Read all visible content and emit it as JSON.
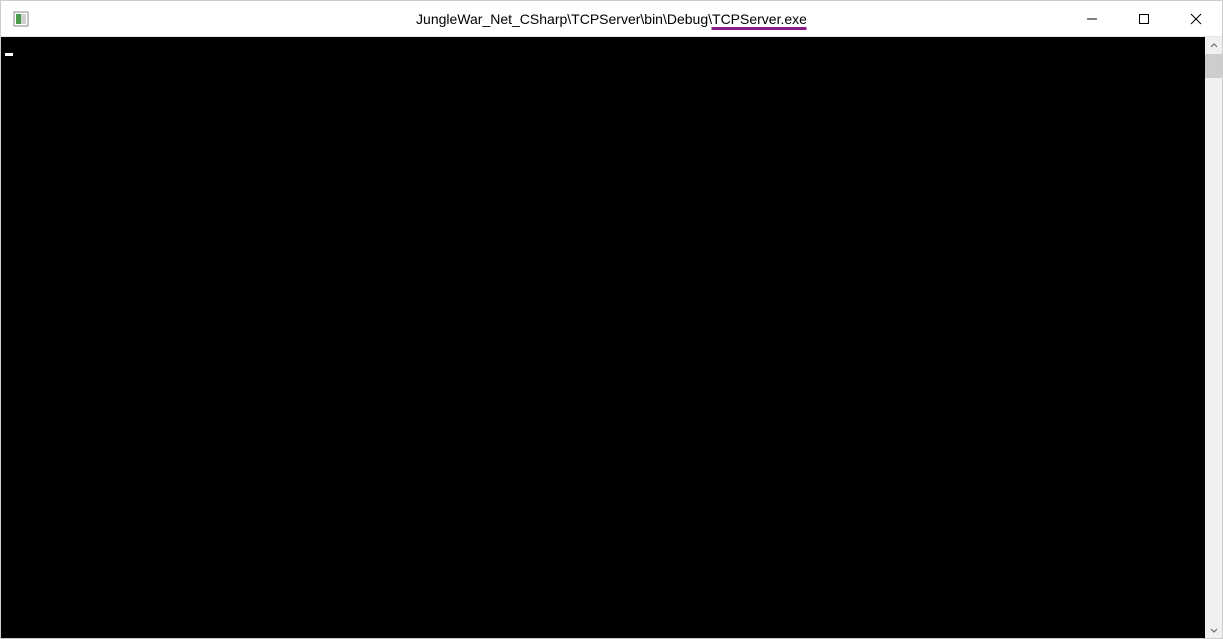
{
  "window": {
    "title_prefix": "JungleWar_Net_CSharp\\TCPServer\\bin\\Debug\\",
    "title_highlighted": "TCPServer.exe"
  },
  "console": {
    "output": ""
  }
}
